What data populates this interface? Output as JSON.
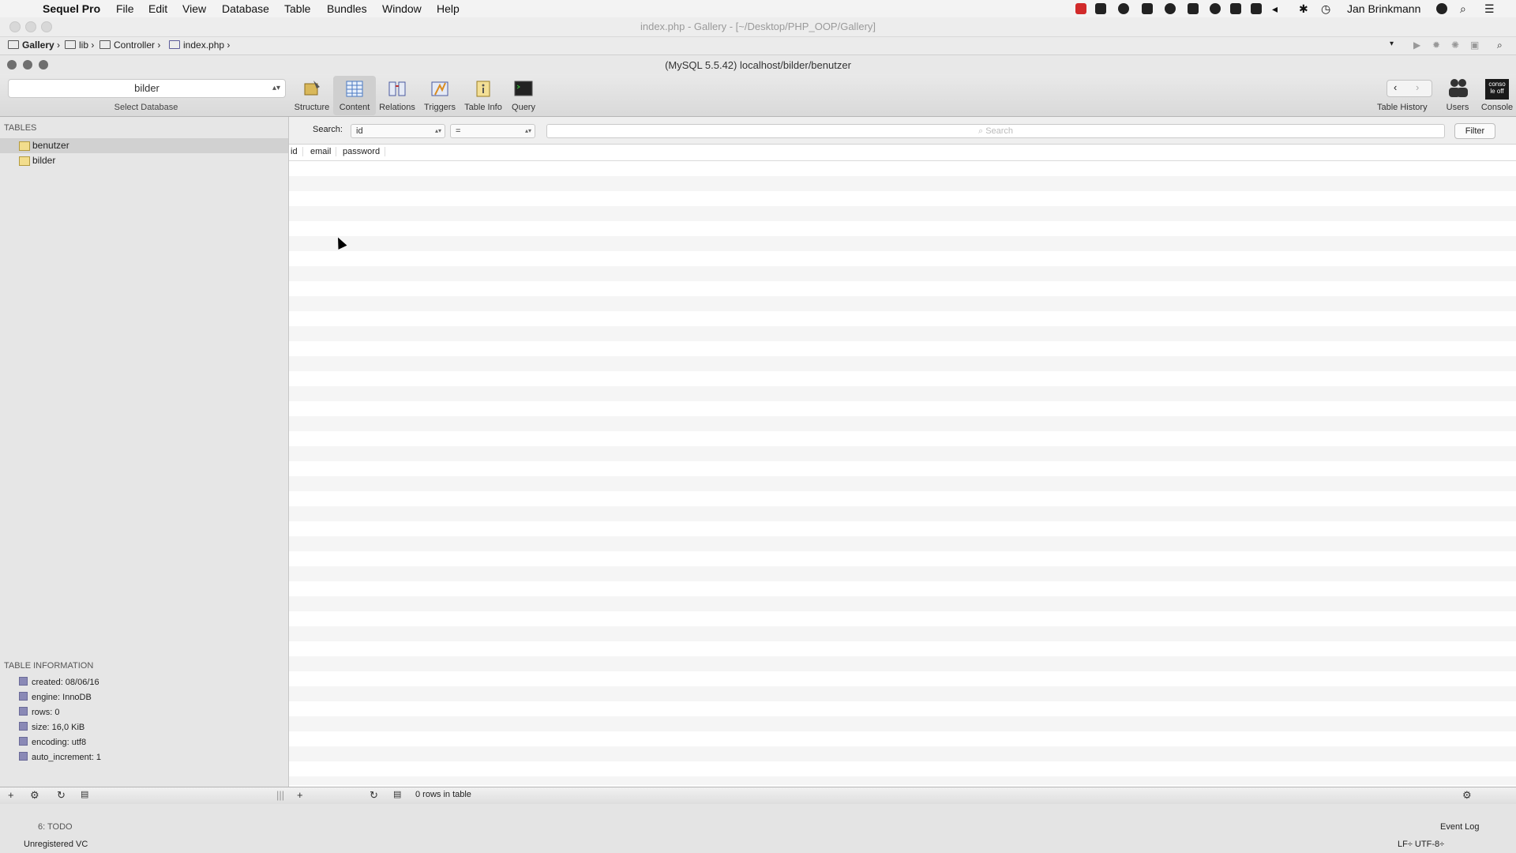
{
  "menubar": {
    "app_name": "Sequel Pro",
    "items": [
      "File",
      "Edit",
      "View",
      "Database",
      "Table",
      "Bundles",
      "Window",
      "Help"
    ],
    "user": "Jan Brinkmann"
  },
  "editor_window": {
    "title": "index.php - Gallery - [~/Desktop/PHP_OOP/Gallery]",
    "breadcrumb": [
      "Gallery",
      "lib",
      "Controller",
      "index.php"
    ]
  },
  "window": {
    "title": "(MySQL 5.5.42) localhost/bilder/benutzer"
  },
  "toolbar": {
    "database_value": "bilder",
    "database_label": "Select Database",
    "buttons": [
      "Structure",
      "Content",
      "Relations",
      "Triggers",
      "Table Info",
      "Query"
    ],
    "active": "Content",
    "right_buttons": [
      "Table History",
      "Users",
      "Console"
    ]
  },
  "sidebar": {
    "tables_header": "TABLES",
    "tables": [
      "benutzer",
      "bilder"
    ],
    "selected_table": "benutzer",
    "info_header": "TABLE INFORMATION",
    "info": [
      "created: 08/06/16",
      "engine: InnoDB",
      "rows: 0",
      "size: 16,0 KiB",
      "encoding: utf8",
      "auto_increment: 1"
    ]
  },
  "filter": {
    "label": "Search:",
    "field": "id",
    "operator": "=",
    "placeholder": "Search",
    "button": "Filter"
  },
  "table": {
    "columns": [
      "id",
      "email",
      "password"
    ]
  },
  "status": {
    "row_count": "0 rows in table"
  },
  "editor_status": {
    "todo": "6: TODO",
    "unregistered": "Unregistered VC",
    "event_log": "Event Log",
    "encoding": "LF÷  UTF-8÷"
  }
}
